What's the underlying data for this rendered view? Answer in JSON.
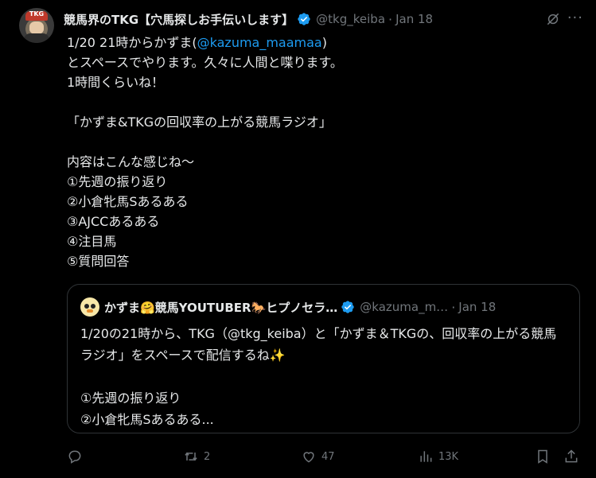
{
  "tweet": {
    "author_name": "競馬界のTKG【穴馬探しお手伝いします】",
    "handle": "@tkg_keiba",
    "separator": "·",
    "date": "Jan 18",
    "text_line1_prefix": "1/20 21時からかずま(",
    "mention": "@kazuma_maamaa",
    "text_line1_suffix": ")",
    "text_rest": "とスペースでやります。久々に人間と喋ります。\n1時間くらいね！\n\n「かずま&TKGの回収率の上がる競馬ラジオ」\n\n内容はこんな感じね〜\n①先週の振り返り\n②小倉牝馬Sあるある\n③AJCCあるある\n④注目馬\n⑤質問回答"
  },
  "avatar": {
    "cap_text": "TKG"
  },
  "quote": {
    "author_name": "かずま🤗競馬YOUTUBER🐎ヒプノセラ…",
    "handle": "@kazuma_m…",
    "separator": "·",
    "date": "Jan 18",
    "text": "1/20の21時から、TKG（@tkg_keiba）と「かずま＆TKGの、回収率の上がる競馬ラジオ」をスペースで配信するね✨\n\n①先週の振り返り\n②小倉牝馬Sあるある..."
  },
  "actions": {
    "reply_count": "",
    "retweet_count": "2",
    "like_count": "47",
    "views_count": "13K"
  },
  "icons": {
    "verified": "verified-badge-icon",
    "grok": "grok-icon",
    "more": "more-icon",
    "reply": "reply-icon",
    "retweet": "retweet-icon",
    "like": "heart-icon",
    "views": "views-icon",
    "bookmark": "bookmark-icon",
    "share": "share-icon"
  },
  "colors": {
    "accent": "#1d9bf0",
    "muted": "#71767b",
    "text": "#e7e9ea",
    "background": "#000000"
  }
}
